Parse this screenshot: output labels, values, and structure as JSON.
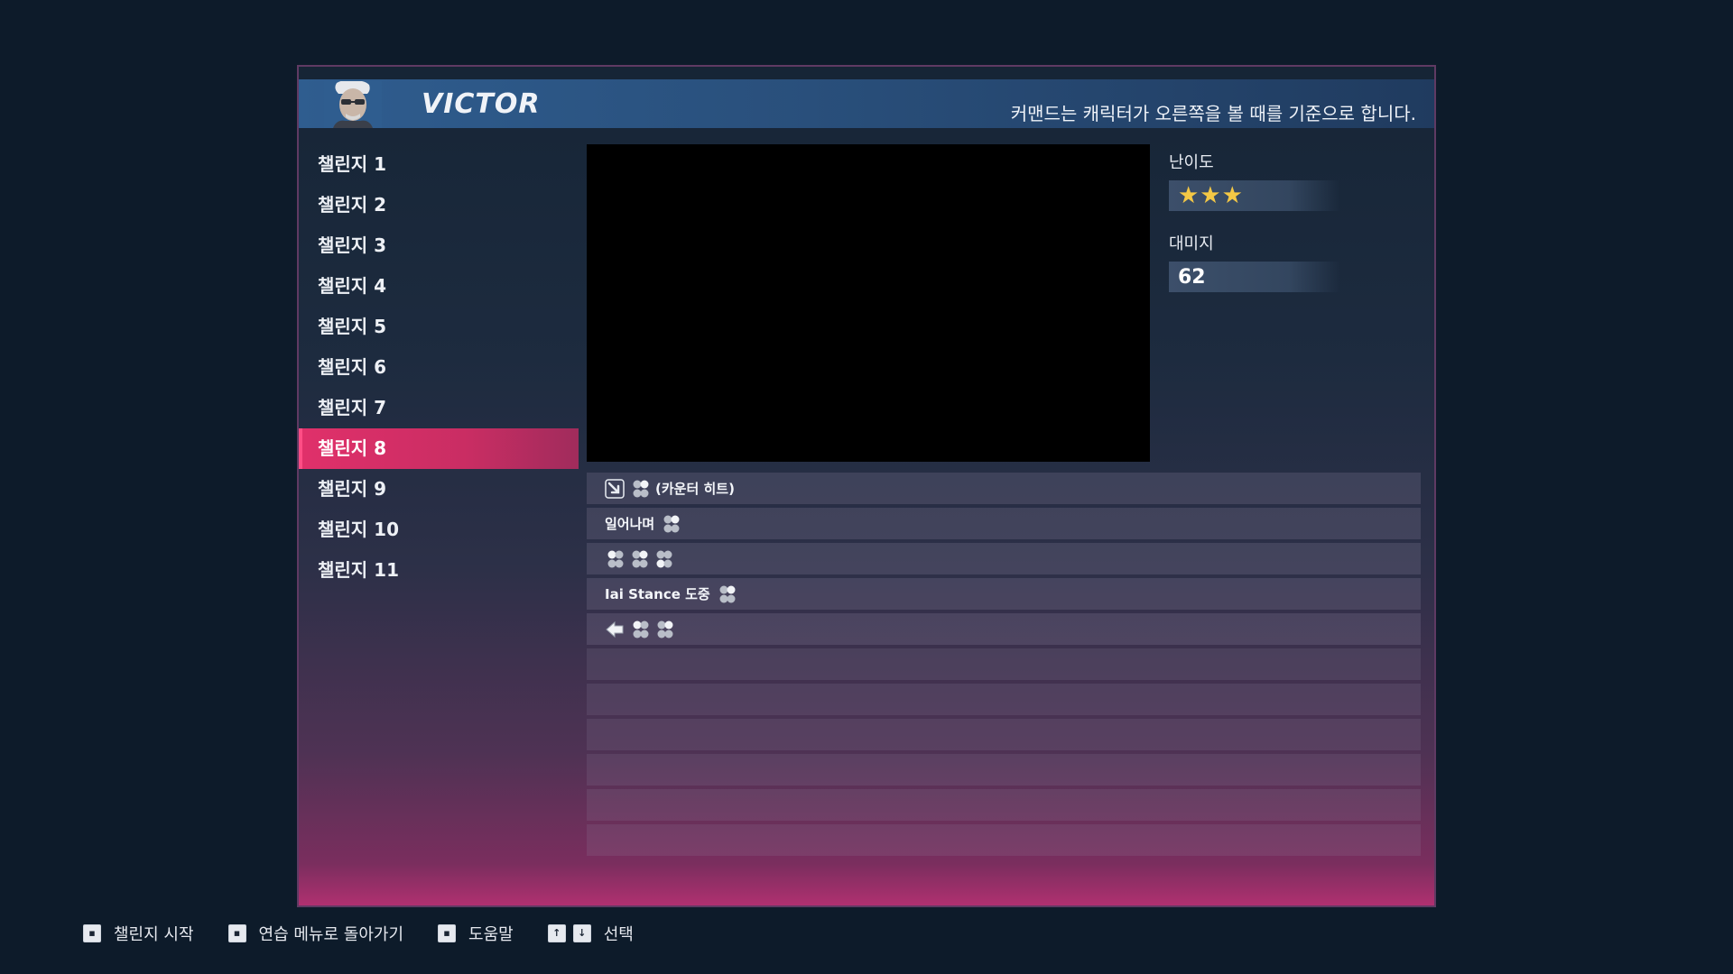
{
  "header": {
    "character_name": "VICTOR",
    "note": "커맨드는 캐릭터가 오른쪽을 볼 때를 기준으로 합니다."
  },
  "challenges": [
    {
      "label": "챌린지 1"
    },
    {
      "label": "챌린지 2"
    },
    {
      "label": "챌린지 3"
    },
    {
      "label": "챌린지 4"
    },
    {
      "label": "챌린지 5"
    },
    {
      "label": "챌린지 6"
    },
    {
      "label": "챌린지 7"
    },
    {
      "label": "챌린지 8",
      "selected": true
    },
    {
      "label": "챌린지 9"
    },
    {
      "label": "챌린지 10"
    },
    {
      "label": "챌린지 11"
    }
  ],
  "info": {
    "difficulty_label": "난이도",
    "difficulty_stars": "★★★",
    "difficulty_value": 3,
    "damage_label": "대미지",
    "damage_value": "62"
  },
  "commands": [
    {
      "prefix_icon": "down-forward-arrow-icon",
      "button_icons": [
        "buttons-cluster-icon"
      ],
      "text_after": "(카운터 히트)"
    },
    {
      "text_before": "일어나며",
      "button_icons": [
        "buttons-cluster-icon"
      ]
    },
    {
      "button_icons": [
        "buttons-cluster-icon",
        "buttons-cluster-icon",
        "buttons-cluster-icon"
      ]
    },
    {
      "text_before": "Iai Stance 도중",
      "button_icons": [
        "buttons-cluster-icon"
      ]
    },
    {
      "prefix_icon": "back-arrow-icon",
      "button_icons": [
        "buttons-cluster-icon",
        "buttons-cluster-icon"
      ]
    }
  ],
  "footer": {
    "start_label": "챌린지 시작",
    "back_label": "연습 메뉴로 돌아가기",
    "help_label": "도움말",
    "select_label": "선택"
  },
  "colors": {
    "selected_accent": "#e0306a",
    "star": "#f4c845",
    "header_blue": "#2f5d8f"
  }
}
